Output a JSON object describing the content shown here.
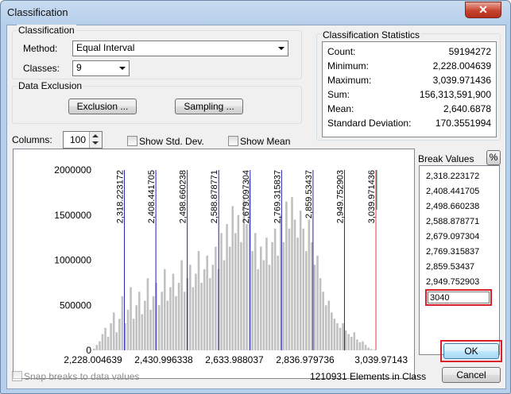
{
  "window": {
    "title": "Classification",
    "close_glyph": "✕"
  },
  "classification": {
    "group_label": "Classification",
    "method_label": "Method:",
    "method_value": "Equal Interval",
    "classes_label": "Classes:",
    "classes_value": "9"
  },
  "exclusion": {
    "group_label": "Data Exclusion",
    "exclusion_button": "Exclusion ...",
    "sampling_button": "Sampling ..."
  },
  "stats": {
    "group_label": "Classification Statistics",
    "rows": [
      {
        "label": "Count:",
        "value": "59194272"
      },
      {
        "label": "Minimum:",
        "value": "2,228.004639"
      },
      {
        "label": "Maximum:",
        "value": "3,039.971436"
      },
      {
        "label": "Sum:",
        "value": "156,313,591,900"
      },
      {
        "label": "Mean:",
        "value": "2,640.6878"
      },
      {
        "label": "Standard Deviation:",
        "value": "170.3551994"
      }
    ]
  },
  "controls": {
    "columns_label": "Columns:",
    "columns_value": "100",
    "show_std_dev": "Show Std. Dev.",
    "show_mean": "Show Mean"
  },
  "break_values": {
    "label": "Break Values",
    "percent_button": "%",
    "items": [
      "2,318.223172",
      "2,408.441705",
      "2,498.660238",
      "2,588.878771",
      "2,679.097304",
      "2,769.315837",
      "2,859.53437",
      "2,949.752903"
    ],
    "edit_value": "3040"
  },
  "buttons": {
    "ok": "OK",
    "cancel": "Cancel"
  },
  "footer": {
    "snap_label": "Snap breaks to data values",
    "elements_text": "1210931 Elements in Class"
  },
  "colors": {
    "bar": "#c0c0c0",
    "break_line": "#1f1fb3",
    "last_break": "#d04040",
    "max_line": "#2e8b57",
    "highlight": "#d9212c"
  },
  "chart_data": {
    "type": "bar",
    "title": "",
    "xlabel": "",
    "ylabel": "",
    "xlim": [
      2228.004639,
      3039.971436
    ],
    "ylim": [
      0,
      2000000
    ],
    "y_ticks": [
      "2000000",
      "1500000",
      "1000000",
      "500000",
      "0"
    ],
    "y_tick_values": [
      2000000,
      1500000,
      1000000,
      500000,
      0
    ],
    "x_ticks": [
      "2,228.004639",
      "2,430.996338",
      "2,633.988037",
      "2,836.979736",
      "3,039.97143"
    ],
    "x_tick_values": [
      2228.004639,
      2430.996338,
      2633.988037,
      2836.979736,
      3039.97143
    ],
    "breaks": [
      2318.223172,
      2408.441705,
      2498.660238,
      2588.878771,
      2679.097304,
      2769.315837,
      2859.53437,
      2949.752903,
      3039.971436
    ],
    "break_labels": [
      "2,318.223172",
      "2,408.441705",
      "2,498.660238",
      "2,588.878771",
      "2,679.097304",
      "2,769.315837",
      "2,859.53437",
      "2,949.752903",
      "3,039.971436"
    ],
    "values": [
      20000,
      60000,
      100000,
      180000,
      250000,
      150000,
      300000,
      420000,
      200000,
      350000,
      600000,
      300000,
      450000,
      700000,
      350000,
      500000,
      650000,
      400000,
      550000,
      800000,
      450000,
      600000,
      750000,
      500000,
      650000,
      900000,
      550000,
      700000,
      850000,
      600000,
      750000,
      1000000,
      650000,
      800000,
      950000,
      700000,
      850000,
      1100000,
      750000,
      900000,
      1050000,
      800000,
      950000,
      1150000,
      900000,
      1300000,
      1000000,
      1400000,
      1150000,
      1600000,
      1300000,
      1500000,
      1200000,
      1700000,
      1400000,
      1900000,
      1100000,
      1300000,
      900000,
      1150000,
      1000000,
      1250000,
      950000,
      1200000,
      1350000,
      1050000,
      1500000,
      1200000,
      1650000,
      1350000,
      1700000,
      1450000,
      1250000,
      1550000,
      1350000,
      1100000,
      1450000,
      1200000,
      950000,
      1050000,
      800000,
      650000,
      500000,
      550000,
      420000,
      350000,
      300000,
      250000,
      300000,
      220000,
      180000,
      150000,
      200000,
      120000,
      90000,
      100000,
      60000,
      30000,
      15000,
      5000
    ]
  }
}
